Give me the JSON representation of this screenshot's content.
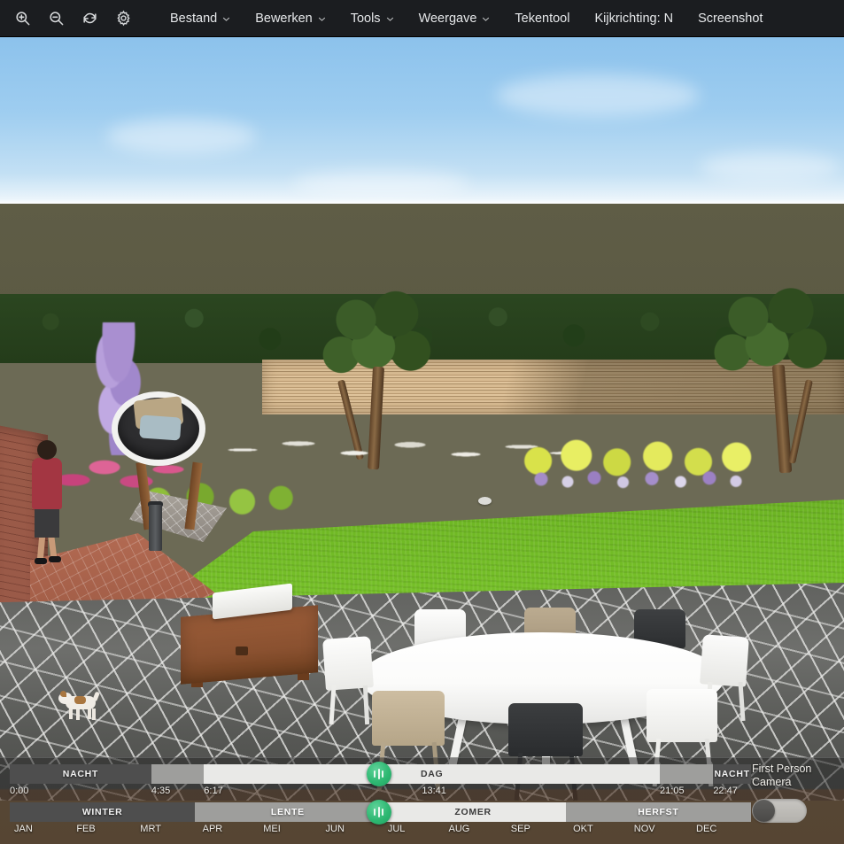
{
  "menubar": {
    "icons": [
      {
        "name": "zoom-in-icon",
        "glyph": "zoom-in"
      },
      {
        "name": "zoom-out-icon",
        "glyph": "zoom-out"
      },
      {
        "name": "refresh-icon",
        "glyph": "refresh"
      },
      {
        "name": "settings-gear-icon",
        "glyph": "gear"
      }
    ],
    "items": [
      {
        "label": "Bestand",
        "caret": true
      },
      {
        "label": "Bewerken",
        "caret": true
      },
      {
        "label": "Tools",
        "caret": true
      },
      {
        "label": "Weergave",
        "caret": true
      },
      {
        "label": "Tekentool",
        "caret": false
      },
      {
        "label": "Kijkrichting: N",
        "caret": false
      },
      {
        "label": "Screenshot",
        "caret": false
      }
    ]
  },
  "viewport": {
    "scene_name": "garden-3d-view",
    "sky_color": "#9ecdf0",
    "lawn_color": "#6fb824",
    "patio_color": "#61625f",
    "fence_color": "#d8bb92",
    "hedge_color": "#2b4620"
  },
  "time_slider": {
    "name": "day-night-slider",
    "handle_percent": 49.8,
    "segments": [
      {
        "label": "NACHT",
        "tone": "dark",
        "percent": 19.1
      },
      {
        "label": "",
        "tone": "mid",
        "percent": 7.1
      },
      {
        "label": "DAG",
        "tone": "light",
        "percent": 61.5
      },
      {
        "label": "",
        "tone": "mid",
        "percent": 7.2
      },
      {
        "label": "NACHT",
        "tone": "dark",
        "percent": 5.1
      }
    ],
    "ticks": [
      {
        "label": "0:00",
        "percent": 0.0
      },
      {
        "label": "4:35",
        "percent": 19.1
      },
      {
        "label": "6:17",
        "percent": 26.2
      },
      {
        "label": "13:41",
        "percent": 55.6
      },
      {
        "label": "21:05",
        "percent": 87.7
      },
      {
        "label": "22:47",
        "percent": 94.9
      }
    ]
  },
  "season_slider": {
    "name": "season-month-slider",
    "handle_percent": 49.8,
    "segments": [
      {
        "label": "WINTER",
        "tone": "dark",
        "percent": 25
      },
      {
        "label": "LENTE",
        "tone": "mid",
        "percent": 25
      },
      {
        "label": "ZOMER",
        "tone": "light",
        "percent": 25
      },
      {
        "label": "HERFST",
        "tone": "mid",
        "percent": 25
      }
    ],
    "months": [
      {
        "label": "JAN",
        "percent": 0.6
      },
      {
        "label": "FEB",
        "percent": 9.0
      },
      {
        "label": "MRT",
        "percent": 17.6
      },
      {
        "label": "APR",
        "percent": 26.0
      },
      {
        "label": "MEI",
        "percent": 34.2
      },
      {
        "label": "JUN",
        "percent": 42.6
      },
      {
        "label": "JUL",
        "percent": 51.0
      },
      {
        "label": "AUG",
        "percent": 59.2
      },
      {
        "label": "SEP",
        "percent": 67.6
      },
      {
        "label": "OKT",
        "percent": 76.0
      },
      {
        "label": "NOV",
        "percent": 84.2
      },
      {
        "label": "DEC",
        "percent": 92.6
      }
    ]
  },
  "first_person_camera": {
    "label_line1": "First Person",
    "label_line2": "Camera",
    "state": "off"
  }
}
